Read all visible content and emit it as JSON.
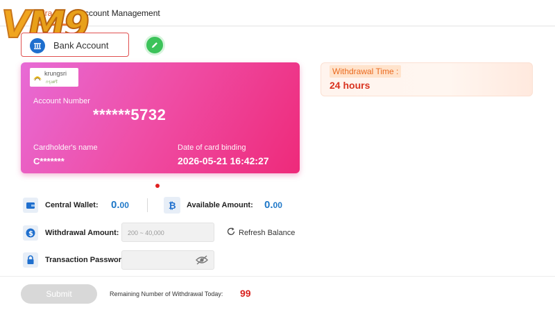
{
  "header": {
    "tab_active": "Withdrawal",
    "tab_active_visible": "dra",
    "tab_account": "ccount Management"
  },
  "logo": {
    "text": "VM9"
  },
  "bank_option": {
    "label": "Bank Account",
    "icon": "bank-icon"
  },
  "edit": {
    "icon": "pencil-icon"
  },
  "card": {
    "bank_name": "krungsri",
    "bank_sub": "กรุงศรี",
    "account_label": "Account Number",
    "account_number": "******5732",
    "holder_label": "Cardholder's name",
    "holder_value": "C*******",
    "binding_label": "Date of card binding",
    "binding_value": "2026-05-21 16:42:27"
  },
  "withdrawal_time": {
    "label": "Withdrawal Time :",
    "value": "24 hours"
  },
  "wallet": {
    "central_label": "Central Wallet:",
    "central_int": "0.",
    "central_dec": "00",
    "available_label": "Available Amount:",
    "available_int": "0.",
    "available_dec": "00"
  },
  "form": {
    "amount_label": "Withdrawal Amount:",
    "amount_placeholder": "200 ~ 40,000",
    "refresh_label": "Refresh Balance",
    "password_label": "Transaction Password:"
  },
  "footer": {
    "submit_label": "Submit",
    "remaining_label": "Remaining Number of Withdrawal Today:",
    "remaining_value": "99"
  },
  "colors": {
    "accent_orange": "#e0561f",
    "amount_blue": "#1f78c8",
    "alert_red": "#d9221f",
    "card_pink": "#ee2a7a"
  }
}
